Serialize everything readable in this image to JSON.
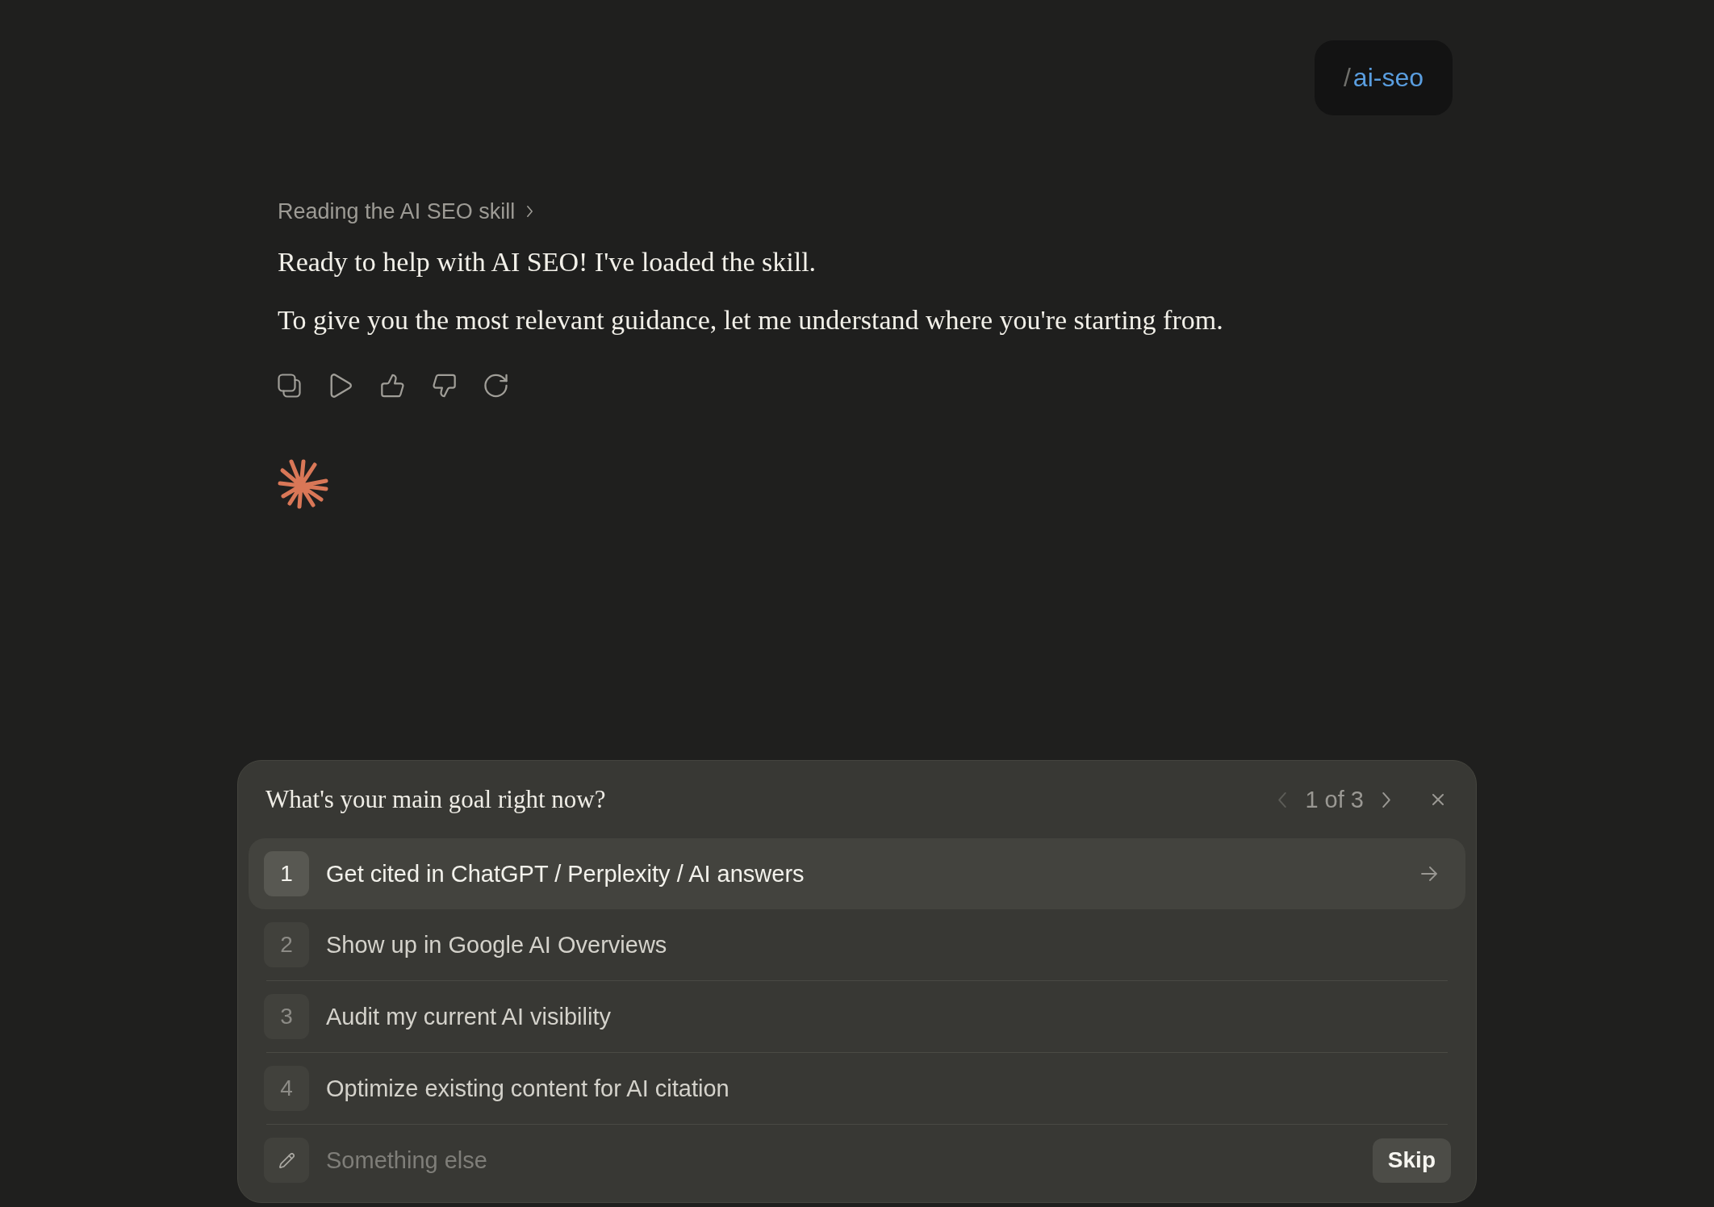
{
  "user_message": {
    "prefix": "/",
    "command": "ai-seo"
  },
  "assistant_message": {
    "tool_step": "Reading the AI SEO skill",
    "paragraphs": [
      "Ready to help with AI SEO! I've loaded the skill.",
      "To give you the most relevant guidance, let me understand where you're starting from."
    ]
  },
  "question": {
    "title": "What's your main goal right now?",
    "pager": {
      "text": "1 of 3",
      "prev_disabled": true,
      "next_disabled": false
    },
    "options": [
      {
        "number": "1",
        "label": "Get cited in ChatGPT / Perplexity / AI answers",
        "selected": true
      },
      {
        "number": "2",
        "label": "Show up in Google AI Overviews",
        "selected": false
      },
      {
        "number": "3",
        "label": "Audit my current AI visibility",
        "selected": false
      },
      {
        "number": "4",
        "label": "Optimize existing content for AI citation",
        "selected": false
      }
    ],
    "custom_answer": {
      "placeholder": "Something else"
    },
    "skip_button": "Skip"
  }
}
